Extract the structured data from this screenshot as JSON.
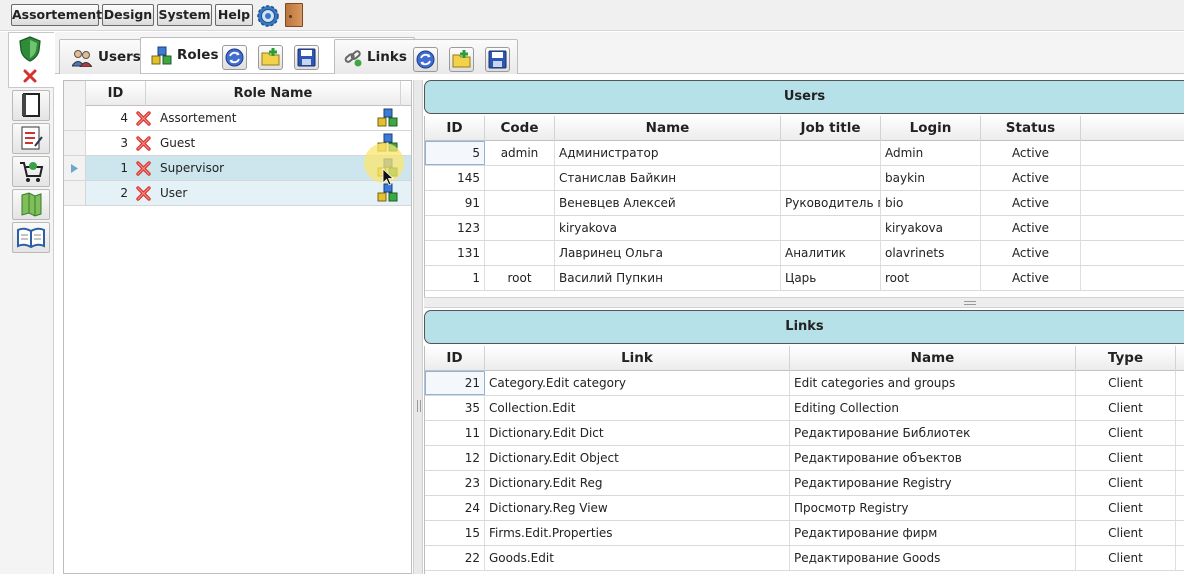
{
  "menu": [
    "Assortement",
    "Design",
    "System",
    "Help"
  ],
  "tabs": {
    "users": "Users",
    "roles": "Roles",
    "links": "Links"
  },
  "roles_grid": {
    "columns": [
      "ID",
      "Role Name"
    ],
    "rows": [
      {
        "id": "4",
        "name": "Assortement"
      },
      {
        "id": "3",
        "name": "Guest"
      },
      {
        "id": "1",
        "name": "Supervisor"
      },
      {
        "id": "2",
        "name": "User"
      }
    ],
    "selected_row": 2
  },
  "users_panel": {
    "title": "Users",
    "columns": [
      "ID",
      "Code",
      "Name",
      "Job title",
      "Login",
      "Status"
    ],
    "rows": [
      {
        "id": "5",
        "code": "admin",
        "name": "Администратор",
        "job": "",
        "login": "Admin",
        "status": "Active"
      },
      {
        "id": "145",
        "code": "",
        "name": "Станислав Байкин",
        "job": "",
        "login": "baykin",
        "status": "Active"
      },
      {
        "id": "91",
        "code": "",
        "name": "Веневцев Алексей",
        "job": "Руководитель п",
        "login": "bio",
        "status": "Active"
      },
      {
        "id": "123",
        "code": "",
        "name": "kiryakova",
        "job": "",
        "login": "kiryakova",
        "status": "Active"
      },
      {
        "id": "131",
        "code": "",
        "name": "Лавринец Ольга",
        "job": "Аналитик",
        "login": "olavrinets",
        "status": "Active"
      },
      {
        "id": "1",
        "code": "root",
        "name": "Василий Пупкин",
        "job": "Царь",
        "login": "root",
        "status": "Active"
      }
    ]
  },
  "links_panel": {
    "title": "Links",
    "columns": [
      "ID",
      "Link",
      "Name",
      "Type"
    ],
    "rows": [
      {
        "id": "21",
        "link": "Category.Edit category",
        "name": "Edit categories and groups",
        "type": "Client"
      },
      {
        "id": "35",
        "link": "Collection.Edit",
        "name": "Editing Collection",
        "type": "Client"
      },
      {
        "id": "11",
        "link": "Dictionary.Edit Dict",
        "name": "Редактирование Библиотек",
        "type": "Client"
      },
      {
        "id": "12",
        "link": "Dictionary.Edit Object",
        "name": "Редактирование объектов",
        "type": "Client"
      },
      {
        "id": "23",
        "link": "Dictionary.Edit Reg",
        "name": "Редактирование Registry",
        "type": "Client"
      },
      {
        "id": "24",
        "link": "Dictionary.Reg View",
        "name": "Просмотр Registry",
        "type": "Client"
      },
      {
        "id": "15",
        "link": "Firms.Edit.Properties",
        "name": "Редактирование фирм",
        "type": "Client"
      },
      {
        "id": "22",
        "link": "Goods.Edit",
        "name": "Редактирование Goods",
        "type": "Client"
      }
    ]
  },
  "colors": {
    "panel_title_bg": "#b7e1e8",
    "selected_row_bg": "#cde6ee",
    "row_alt_bg": "#e4f1f6",
    "delete_red": "#d8312a"
  }
}
